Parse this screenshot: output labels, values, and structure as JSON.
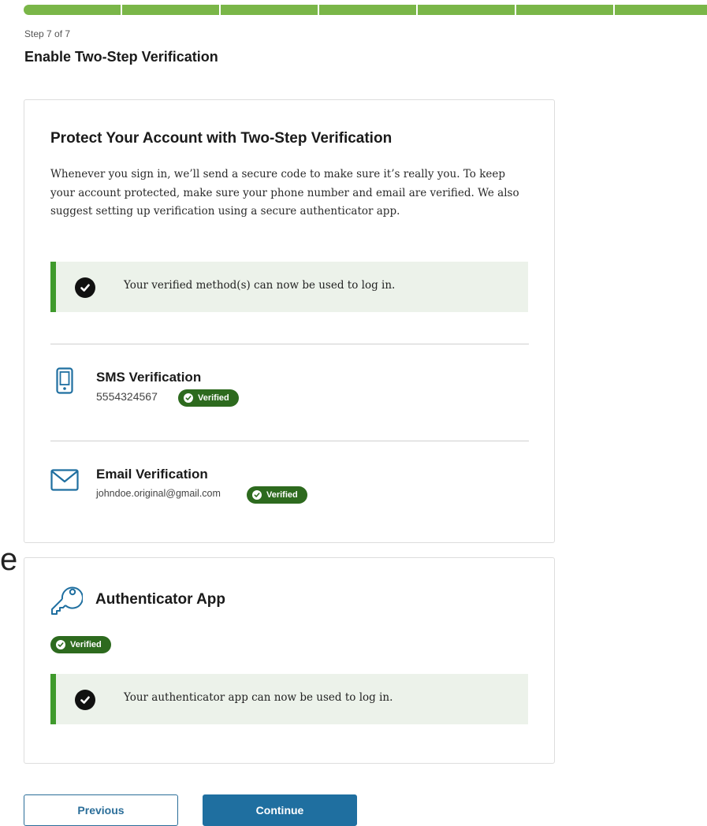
{
  "progress": {
    "total_steps": 7,
    "completed_steps": 7,
    "color": "#7ab648"
  },
  "header": {
    "step_label": "Step 7 of 7",
    "title": "Enable Two-Step Verification"
  },
  "protect_card": {
    "heading": "Protect Your Account with Two-Step Verification",
    "description": "Whenever you sign in, we’ll send a secure code to make sure it’s really you. To keep your account protected, make sure your phone number and email are verified. We also suggest setting up verification using a secure authenticator app.",
    "alert": "Your verified method(s) can now be used to log in.",
    "methods": {
      "sms": {
        "icon": "phone-icon",
        "title": "SMS Verification",
        "value": "5554324567",
        "badge": "Verified"
      },
      "email": {
        "icon": "envelope-icon",
        "title": "Email Verification",
        "value": "johndoe.original@gmail.com",
        "badge": "Verified"
      }
    }
  },
  "authenticator_card": {
    "icon": "key-icon",
    "heading": "Authenticator App",
    "badge": "Verified",
    "alert": "Your authenticator app can now be used to log in."
  },
  "footer": {
    "previous_label": "Previous",
    "continue_label": "Continue"
  },
  "colors": {
    "brand_green": "#3f9a2c",
    "badge_green": "#2d6a1e",
    "alert_bg": "#ecf2ea",
    "icon_blue": "#1f6fa0",
    "primary_button": "#1f6fa0"
  },
  "stray_text": "e"
}
